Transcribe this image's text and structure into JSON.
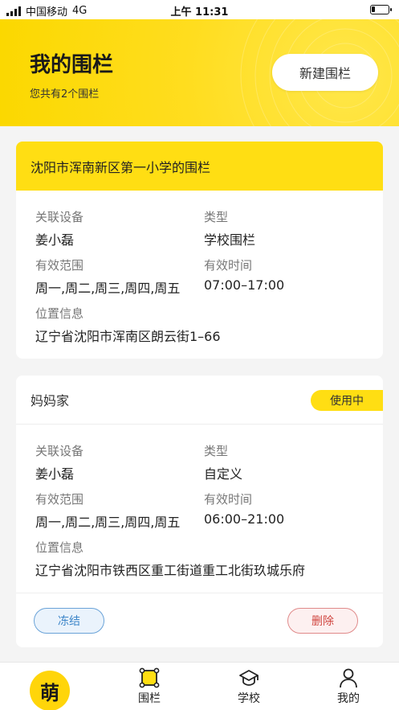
{
  "status_bar": {
    "carrier": "中国移动",
    "network": "4G",
    "time": "上午 11:31",
    "battery_percent": 20
  },
  "header": {
    "title": "我的围栏",
    "subtitle": "您共有2个围栏",
    "new_button": "新建围栏"
  },
  "fences": [
    {
      "name": "沈阳市浑南新区第一小学的围栏",
      "device_label": "关联设备",
      "device": "姜小磊",
      "type_label": "类型",
      "type": "学校围栏",
      "range_label": "有效范围",
      "range": "周一,周二,周三,周四,周五",
      "time_label": "有效时间",
      "time": "07:00–17:00",
      "location_label": "位置信息",
      "location": "辽宁省沈阳市浑南区朗云街1–66"
    },
    {
      "name": "妈妈家",
      "badge": "使用中",
      "device_label": "关联设备",
      "device": "姜小磊",
      "type_label": "类型",
      "type": "自定义",
      "range_label": "有效范围",
      "range": "周一,周二,周三,周四,周五",
      "time_label": "有效时间",
      "time": "06:00–21:00",
      "location_label": "位置信息",
      "location": "辽宁省沈阳市铁西区重工街道重工北街玖城乐府",
      "freeze_button": "冻结",
      "delete_button": "删除"
    }
  ],
  "tab_bar": {
    "logo": "萌",
    "tabs": [
      {
        "label": "围栏",
        "icon": "fence-icon"
      },
      {
        "label": "学校",
        "icon": "school-icon"
      },
      {
        "label": "我的",
        "icon": "profile-icon"
      }
    ]
  },
  "colors": {
    "brand_yellow": "#ffde13",
    "freeze_blue": "#3d86c9",
    "delete_red": "#d0453f"
  }
}
